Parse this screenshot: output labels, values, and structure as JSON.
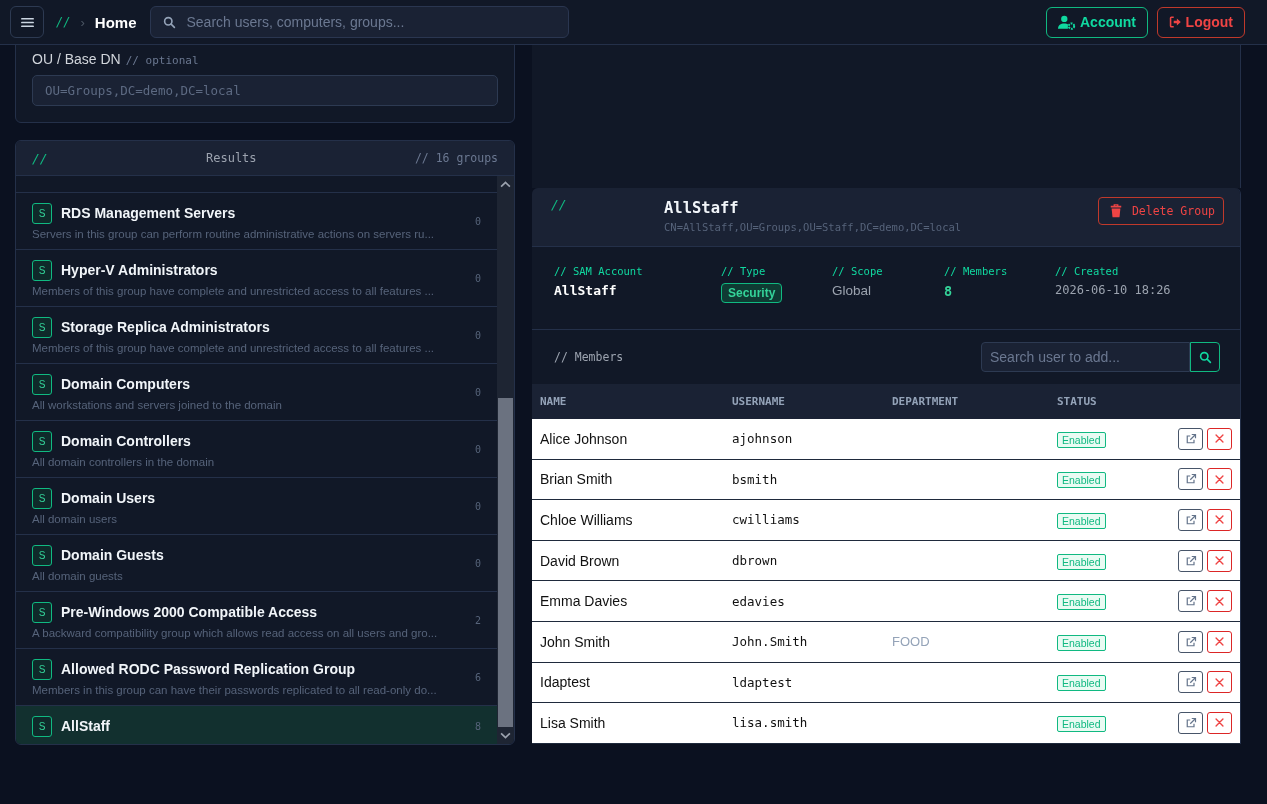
{
  "header": {
    "breadcrumb_prefix": "//",
    "breadcrumb_separator": "›",
    "page": "Home",
    "search": {
      "placeholder": "Search users, computers, groups..."
    },
    "buttons": [
      {
        "kind": "account",
        "label": "Account"
      },
      {
        "kind": "logout",
        "label": "Logout"
      }
    ]
  },
  "filter": {
    "label": "OU / Base DN",
    "hint": "// optional",
    "field": {
      "placeholder": "OU=Groups,DC=demo,DC=local"
    }
  },
  "results": {
    "prefix": "//",
    "title": "Results",
    "count": "// 16 groups",
    "groups": [
      {
        "badge": "S",
        "name": "RDS Management Servers",
        "description": "Servers in this group can perform routine administrative actions on servers ru...",
        "members": "0",
        "selected": false
      },
      {
        "badge": "S",
        "name": "Hyper-V Administrators",
        "description": "Members of this group have complete and unrestricted access to all features ...",
        "members": "0",
        "selected": false
      },
      {
        "badge": "S",
        "name": "Storage Replica Administrators",
        "description": "Members of this group have complete and unrestricted access to all features ...",
        "members": "0",
        "selected": false
      },
      {
        "badge": "S",
        "name": "Domain Computers",
        "description": "All workstations and servers joined to the domain",
        "members": "0",
        "selected": false
      },
      {
        "badge": "S",
        "name": "Domain Controllers",
        "description": "All domain controllers in the domain",
        "members": "0",
        "selected": false
      },
      {
        "badge": "S",
        "name": "Domain Users",
        "description": "All domain users",
        "members": "0",
        "selected": false
      },
      {
        "badge": "S",
        "name": "Domain Guests",
        "description": "All domain guests",
        "members": "0",
        "selected": false
      },
      {
        "badge": "S",
        "name": "Pre-Windows 2000 Compatible Access",
        "description": "A backward compatibility group which allows read access on all users and gro...",
        "members": "2",
        "selected": false
      },
      {
        "badge": "S",
        "name": "Allowed RODC Password Replication Group",
        "description": "Members in this group can have their passwords replicated to all read-only do...",
        "members": "6",
        "selected": false
      },
      {
        "badge": "S",
        "name": "AllStaff",
        "members": "8",
        "selected": true
      }
    ]
  },
  "details": {
    "prefix": "//",
    "name": "AllStaff",
    "dn": "CN=AllStaff,OU=Groups,OU=Staff,DC=demo,DC=local",
    "delete_button": "Delete Group",
    "fields": [
      {
        "label": "// SAM Account",
        "value": "AllStaff",
        "kind": "mono"
      },
      {
        "label": "// Type",
        "value": "Security",
        "kind": "badge"
      },
      {
        "label": "// Scope",
        "value": "Global",
        "kind": "plain"
      },
      {
        "label": "// Members",
        "value": "8",
        "kind": "accent"
      },
      {
        "label": "// Created",
        "value": "2026-06-10 18:26",
        "kind": "date"
      }
    ],
    "members_title": "// Members",
    "member_search": {
      "placeholder": "Search user to add..."
    },
    "table": {
      "columns": [
        "NAME",
        "USERNAME",
        "DEPARTMENT",
        "STATUS"
      ],
      "rows": [
        {
          "name": "Alice Johnson",
          "username": "ajohnson",
          "status": "Enabled"
        },
        {
          "name": "Brian Smith",
          "username": "bsmith",
          "status": "Enabled"
        },
        {
          "name": "Chloe Williams",
          "username": "cwilliams",
          "status": "Enabled"
        },
        {
          "name": "David Brown",
          "username": "dbrown",
          "status": "Enabled"
        },
        {
          "name": "Emma Davies",
          "username": "edavies",
          "status": "Enabled"
        },
        {
          "name": "John Smith",
          "username": "John.Smith",
          "department": "FOOD",
          "status": "Enabled"
        },
        {
          "name": "Idaptest",
          "username": "ldaptest",
          "status": "Enabled"
        },
        {
          "name": "Lisa Smith",
          "username": "lisa.smith",
          "status": "Enabled"
        }
      ]
    }
  }
}
